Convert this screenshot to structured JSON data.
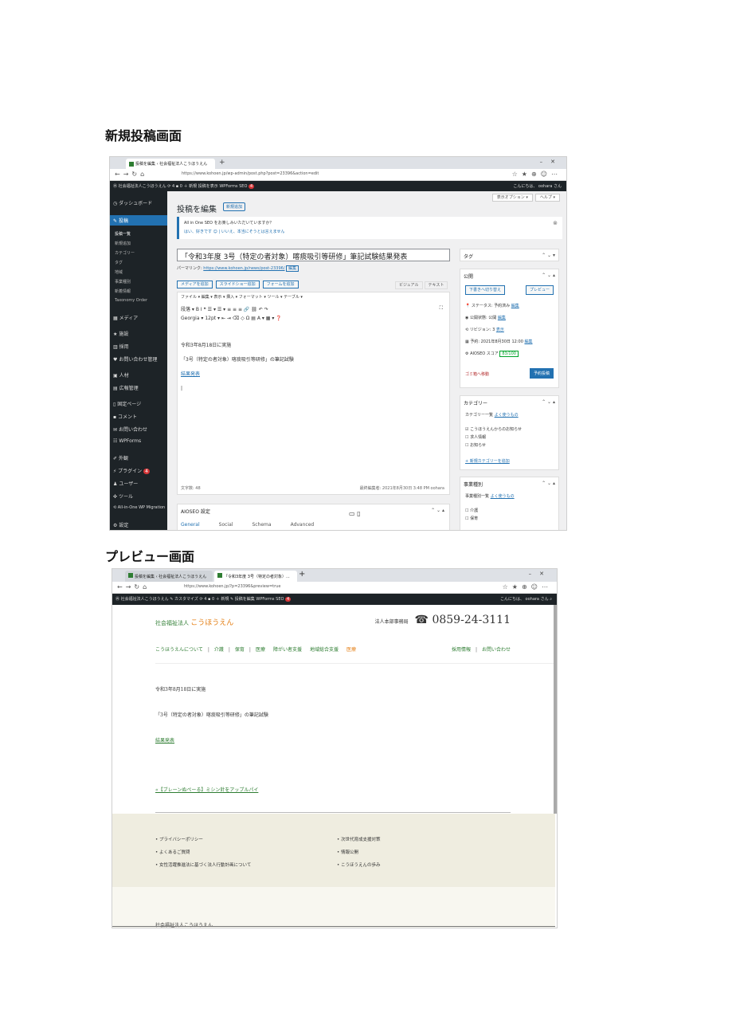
{
  "headings": {
    "new_post": "新規投稿画面",
    "preview": "プレビュー画面"
  },
  "shot1": {
    "browser": {
      "tab_title": "投稿を編集 ‹ 社会福祉法人こうほうえん",
      "url": "https://www.kohoen.jp/wp-admin/post.php?post=23396&action=edit"
    },
    "adminbar": {
      "site": "社会福祉法人こうほうえん",
      "updates": "4",
      "comments": "0",
      "new": "＋ 新規",
      "view": "投稿を表示",
      "wpforms": "WPForms",
      "seo": "SEO",
      "seo_badge": "4",
      "greeting": "こんにちは、 oohara さん"
    },
    "sidebar": {
      "dashboard": "ダッシュボード",
      "posts": "投稿",
      "sub_all": "投稿一覧",
      "sub_new": "新規追加",
      "sub_cat": "カテゴリー",
      "sub_tag": "タグ",
      "sub_region": "地域",
      "sub_type": "事業種別",
      "sub_news": "新着情報",
      "sub_order": "Taxonomy Order",
      "media": "メディア",
      "facility": "施設",
      "recruit": "採用",
      "contact": "お問い合わせ管理",
      "staff": "人材",
      "ads": "広報管理",
      "pages": "固定ページ",
      "comments": "コメント",
      "inquiry": "お問い合わせ",
      "wpforms": "WPForms",
      "appearance": "外観",
      "plugins": "プラグイン",
      "plugins_badge": "4",
      "users": "ユーザー",
      "tools": "ツール",
      "migration": "All-in-One WP Migration",
      "settings": "設定"
    },
    "main": {
      "title": "投稿を編集",
      "add_new": "新規追加",
      "screen_options": "表示オプション ▾",
      "help": "ヘルプ ▾",
      "notice_text": "All in One SEO をお楽しみいただいていますか？",
      "notice_yes": "はい、好きです",
      "notice_no": "いいえ、本当にそうとは言えません",
      "post_title": "「令和3年度 3号（特定の者対象）喀痰吸引等研修」筆記試験結果発表",
      "permalink_label": "パーマリンク:",
      "permalink_url": "https://www.kohoen.jp/news/post-23396/",
      "permalink_edit": "編集",
      "btn_media": "メディアを追加",
      "btn_slider": "スライドショー追加",
      "btn_form": "フォームを追加",
      "tab_visual": "ビジュアル",
      "tab_text": "テキスト",
      "menubar": "ファイル ▾ 編集 ▾ 表示 ▾ 挿入 ▾ フォーマット ▾ ツール ▾ テーブル ▾",
      "toolbar1": "段落  ▾  B  I  ❝  ☰ ▾  ☰ ▾  ≡  ≡  ≡  🔗  ⛓  ↶  ↷",
      "toolbar2": "Georgia  ▾  12pt  ▾  ⇤  ⇥  ⌫  ◇  Ω  ▤  A ▾  ▦ ▾  ❓",
      "fullscreen": "⛶",
      "line1": "令和3年8月18日に実施",
      "line2": "「3号（特定の者対象）喀痰吸引等研修」の筆記試験",
      "line3": "結果発表",
      "cursor": "|",
      "wordcount": "文字数: 48",
      "lastedit": "最終編集者: 2021年8月30日 3:48 PM  oohara",
      "seo_box": "AIOSEO 設定",
      "seo_tab_general": "General",
      "seo_tab_social": "Social",
      "seo_tab_schema": "Schema",
      "seo_tab_adv": "Advanced"
    },
    "tag_box": {
      "title": "タグ"
    },
    "publish_box": {
      "title": "公開",
      "save_draft": "下書きへ切り替え",
      "preview": "プレビュー",
      "status": "ステータス: 予約済み",
      "status_edit": "編集",
      "visibility": "公開状態: 公開",
      "visibility_edit": "編集",
      "revisions": "リビジョン: 3",
      "revisions_browse": "表示",
      "schedule": "予約: 2021年8月30日 12:00",
      "schedule_edit": "編集",
      "seo_score_label": "AIOSEO スコア",
      "seo_score": "83/100",
      "trash": "ゴミ箱へ移動",
      "update": "予約投稿"
    },
    "category_box": {
      "title": "カテゴリー",
      "tab_all": "カテゴリー一覧",
      "tab_popular": "よく使うもの",
      "cat1": "こうほうえんからのお知らせ",
      "cat2": "求人情報",
      "cat3": "お知らせ",
      "add_new": "+ 新規カテゴリーを追加"
    },
    "type_box": {
      "title": "事業種別",
      "tab_all": "事業種別一覧",
      "tab_popular": "よく使うもの",
      "item1": "介護",
      "item2": "保育"
    }
  },
  "shot2": {
    "browser": {
      "tab1": "投稿を編集 ‹ 社会福祉法人こうほうえん",
      "tab2": "「令和3年度 3号（特定の者対象）...",
      "url": "https://www.kohoen.jp/?p=23396&preview=true"
    },
    "adminbar": {
      "site": "社会福祉法人こうほうえん",
      "customize": "カスタマイズ",
      "updates": "4",
      "comments": "0",
      "new": "＋ 新規",
      "edit": "投稿を編集",
      "wpforms": "WPForms",
      "seo": "SEO",
      "seo_badge": "4",
      "greeting": "こんにちは、 oohara さん"
    },
    "header": {
      "logo_small": "社会福祉法人",
      "logo_big": "こうほうえん",
      "phone_label": "法人本部事務局",
      "phone": "0859-24-3111"
    },
    "nav": {
      "about": "こうほうえんについて",
      "care": "介護",
      "childcare": "保育",
      "medical": "医療",
      "disability": "障がい者支援",
      "community": "地域総合支援",
      "other": "医療",
      "recruit": "採用情報",
      "contact": "お問い合わせ"
    },
    "article": {
      "line1": "令和3年8月18日に実施",
      "line2": "「3号（特定の者対象）喀痰吸引等研修」の筆記試験",
      "line3": "結果発表",
      "prev_link": "«【ブレーンぬぺーる】ミシン針をアップルパイ"
    },
    "footer": {
      "col1": [
        "• プライバシーポリシー",
        "• よくあるご質問",
        "• 女性活躍推進法に基づく法人行動計画について"
      ],
      "col2": [
        "• 次世代育成支援対策",
        "• 情報公開",
        "• こうほうえんの歩み"
      ],
      "copyright": "社会福祉法人こうほうえん"
    }
  }
}
